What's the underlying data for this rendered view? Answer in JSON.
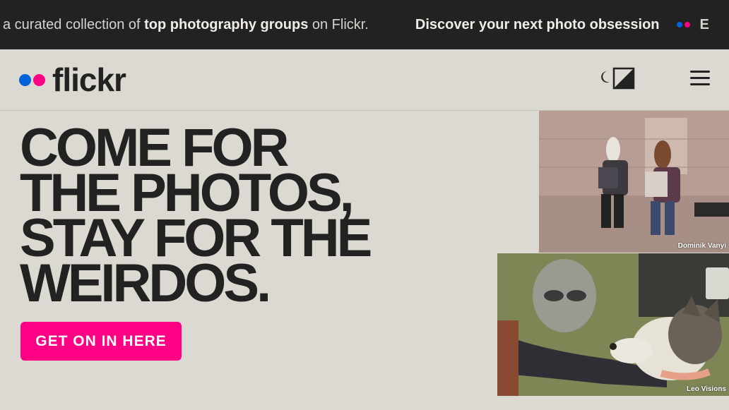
{
  "ticker": {
    "part1_prefix": "a curated collection of ",
    "part1_bold": "top photography groups",
    "part1_suffix": " on Flickr.",
    "part2": "Discover your next photo obsession",
    "cut_off_text": "E"
  },
  "header": {
    "logo_text": "flickr",
    "theme_toggle_icon": "theme-toggle-icon",
    "menu_icon": "hamburger-menu-icon"
  },
  "hero": {
    "title_lines": [
      "COME FOR",
      "THE PHOTOS,",
      "STAY FOR THE",
      "WEIRDOS."
    ],
    "cta_label": "GET ON IN HERE"
  },
  "photos": [
    {
      "credit": "Dominik Vanyi",
      "subject": "two people in horse masks playing accordions"
    },
    {
      "credit": "Leo Visions",
      "subject": "person in alien mask petting a husky dog"
    }
  ],
  "colors": {
    "brand_blue": "#0063dc",
    "brand_pink": "#ff0084",
    "background": "#dcd9d2",
    "ticker_bg": "#222222",
    "text_dark": "#222222"
  }
}
